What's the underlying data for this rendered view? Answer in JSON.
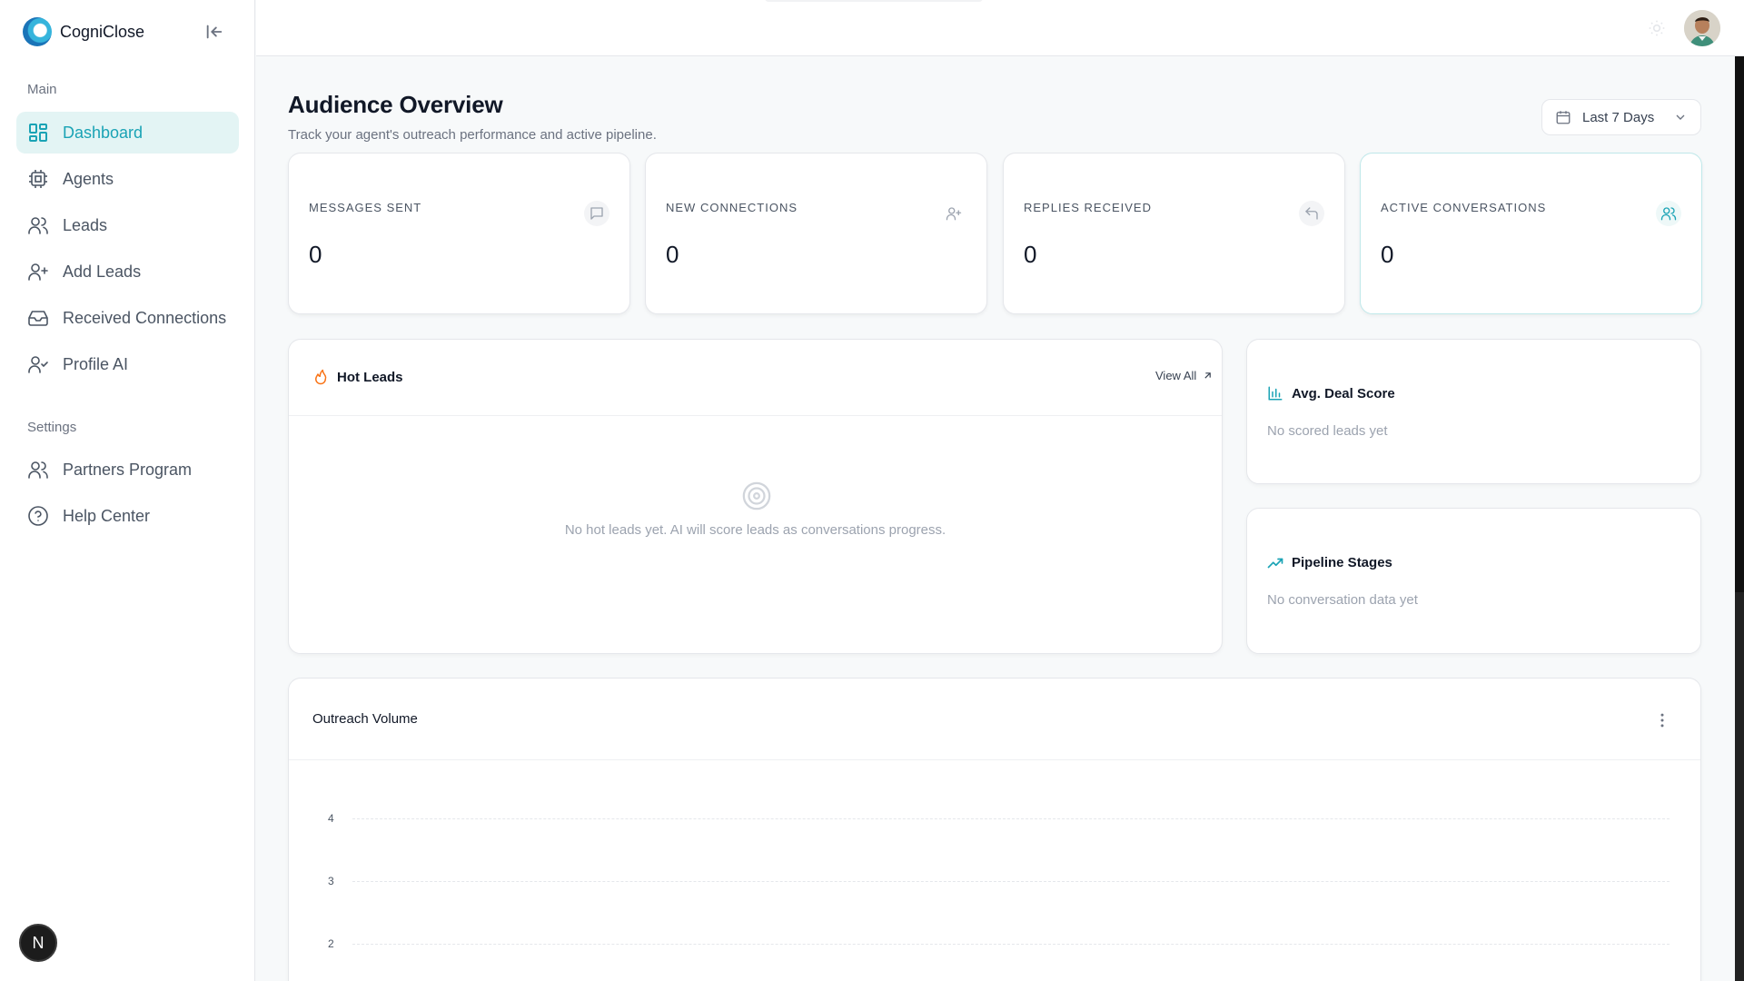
{
  "brand": {
    "name": "CogniClose"
  },
  "sidebar": {
    "sections": [
      {
        "label": "Main"
      },
      {
        "label": "Settings"
      }
    ],
    "items": [
      {
        "label": "Dashboard",
        "icon": "dashboard-icon",
        "active": true
      },
      {
        "label": "Agents",
        "icon": "cpu-icon"
      },
      {
        "label": "Leads",
        "icon": "users-icon"
      },
      {
        "label": "Add Leads",
        "icon": "user-plus-icon"
      },
      {
        "label": "Received Connections",
        "icon": "inbox-icon"
      },
      {
        "label": "Profile AI",
        "icon": "user-check-icon"
      },
      {
        "label": "Partners Program",
        "icon": "users-icon"
      },
      {
        "label": "Help Center",
        "icon": "help-circle-icon"
      }
    ]
  },
  "badge": {
    "letter": "N"
  },
  "header": {
    "title": "Audience Overview",
    "subtitle": "Track your agent's outreach performance and active pipeline.",
    "date_range": "Last 7 Days"
  },
  "stats": [
    {
      "label": "MESSAGES SENT",
      "value": "0",
      "icon": "message-icon"
    },
    {
      "label": "NEW CONNECTIONS",
      "value": "0",
      "icon": "user-plus-icon"
    },
    {
      "label": "REPLIES RECEIVED",
      "value": "0",
      "icon": "reply-icon"
    },
    {
      "label": "ACTIVE CONVERSATIONS",
      "value": "0",
      "icon": "users-icon"
    }
  ],
  "hot_leads": {
    "title": "Hot Leads",
    "view_all": "View All",
    "empty": "No hot leads yet. AI will score leads as conversations progress."
  },
  "deal_score": {
    "title": "Avg. Deal Score",
    "empty": "No scored leads yet"
  },
  "pipeline": {
    "title": "Pipeline Stages",
    "empty": "No conversation data yet"
  },
  "outreach": {
    "title": "Outreach Volume"
  },
  "chart_data": {
    "type": "line",
    "title": "Outreach Volume",
    "y_ticks": [
      "4",
      "3",
      "2"
    ],
    "grid": true
  },
  "colors": {
    "accent": "#1aa3b5",
    "hot": "#f97316",
    "active_bg": "#e3f4f4"
  }
}
